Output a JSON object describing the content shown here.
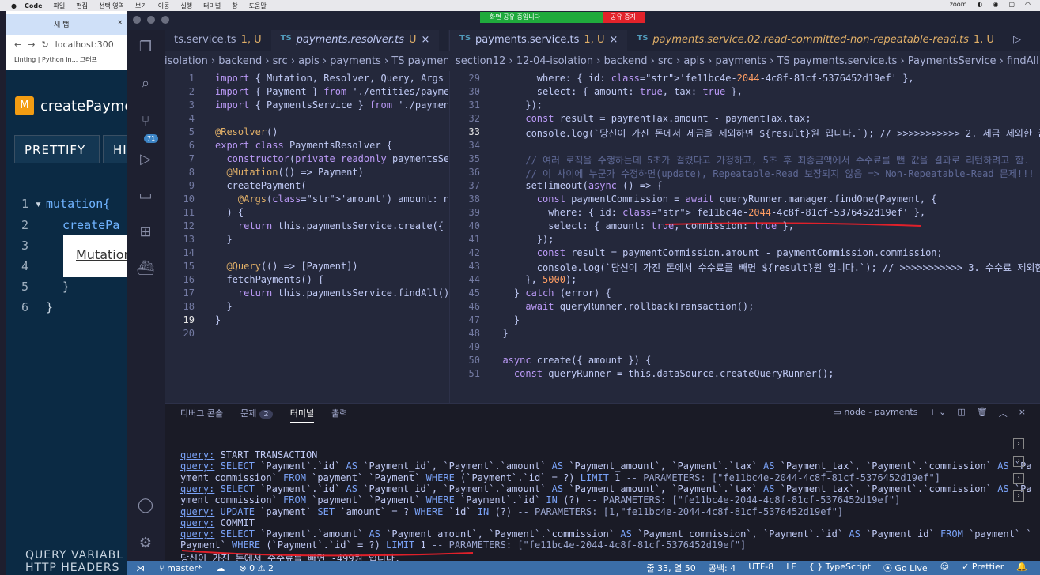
{
  "mac_menu": {
    "app": "Code",
    "items": [
      "파일",
      "편집",
      "선택 영역",
      "보기",
      "이동",
      "실행",
      "터미널",
      "창",
      "도움말"
    ],
    "right": [
      "zoom"
    ]
  },
  "share_bar": {
    "status": "화면 공유 중입니다",
    "stop": "공유 중지"
  },
  "browser": {
    "tab_title": "새 탭",
    "address": "localhost:300",
    "bookmark": "Linting | Python in...",
    "bookmark2": "그래프"
  },
  "graphql": {
    "title": "createPayme",
    "prettify": "PRETTIFY",
    "history": "HIS",
    "code_lines": [
      {
        "num": "1",
        "text": "mutation{"
      },
      {
        "num": "2",
        "text": "createPa"
      },
      {
        "num": "3",
        "text": ""
      },
      {
        "num": "4",
        "text": ""
      },
      {
        "num": "5",
        "text": "}"
      },
      {
        "num": "6",
        "text": "}"
      }
    ],
    "tooltip": "Mutation",
    "query_variables": "QUERY VARIABL",
    "http_headers": "HTTP HEADERS"
  },
  "editor_left": {
    "tabs": [
      {
        "name": "ts.service.ts",
        "suffix": "1, U",
        "active": false
      },
      {
        "name": "payments.resolver.ts",
        "suffix": "U",
        "active": true
      }
    ],
    "breadcrumb": "isolation  ›  backend  ›  src  ›  apis  ›  payments  ›  TS payments",
    "lines": [
      "import { Mutation, Resolver, Query, Args }",
      "import { Payment } from './entities/paymen",
      "import { PaymentsService } from './payment",
      "",
      "@Resolver()",
      "export class PaymentsResolver {",
      "  constructor(private readonly paymentsSer",
      "  @Mutation(() => Payment)",
      "  createPayment(",
      "    @Args('amount') amount: number, //",
      "  ) {",
      "    return this.paymentsService.create({ a",
      "  }",
      "",
      "  @Query(() => [Payment])",
      "  fetchPayments() {",
      "    return this.paymentsService.findAll();",
      "  }",
      "}",
      ""
    ]
  },
  "editor_right": {
    "tabs": [
      {
        "name": "payments.service.ts",
        "suffix": "1, U",
        "active": true
      },
      {
        "name": "payments.service.02.read-committed-non-repeatable-read.ts",
        "suffix": "1, U",
        "active": false
      }
    ],
    "breadcrumb": "section12  ›  12-04-isolation  ›  backend  ›  src  ›  apis  ›  payments  ›  TS payments.service.ts  ›  PaymentsService  ›  findAll",
    "lines": [
      {
        "n": "29",
        "t": "        where: { id: 'fe11bc4e-2044-4c8f-81cf-5376452d19ef' },"
      },
      {
        "n": "30",
        "t": "        select: { amount: true, tax: true },"
      },
      {
        "n": "31",
        "t": "      });"
      },
      {
        "n": "32",
        "t": "      const result = paymentTax.amount - paymentTax.tax;"
      },
      {
        "n": "33",
        "t": "      console.log(`당신이 가진 돈에서 세금을 제외하면 ${result}원 입니다.`); // >>>>>>>>>>> 2. 세금 제외한 금액"
      },
      {
        "n": "34",
        "t": ""
      },
      {
        "n": "35",
        "t": "      // 여러 로직을 수행하는데 5초가 걸렸다고 가정하고, 5초 후 최종금액에서 수수료를 뺀 값을 결과로 리턴하려고 함."
      },
      {
        "n": "36",
        "t": "      // 이 사이에 누군가 수정하면(update), Repeatable-Read 보장되지 않음 => Non-Repeatable-Read 문제!!!"
      },
      {
        "n": "37",
        "t": "      setTimeout(async () => {"
      },
      {
        "n": "38",
        "t": "        const paymentCommission = await queryRunner.manager.findOne(Payment, {"
      },
      {
        "n": "39",
        "t": "          where: { id: 'fe11bc4e-2044-4c8f-81cf-5376452d19ef' },"
      },
      {
        "n": "40",
        "t": "          select: { amount: true, commission: true },"
      },
      {
        "n": "41",
        "t": "        });"
      },
      {
        "n": "42",
        "t": "        const result = paymentCommission.amount - paymentCommission.commission;"
      },
      {
        "n": "43",
        "t": "        console.log(`당신이 가진 돈에서 수수료를 빼면 ${result}원 입니다.`); // >>>>>>>>>>> 3. 수수료 제외한 금"
      },
      {
        "n": "44",
        "t": "      }, 5000);"
      },
      {
        "n": "45",
        "t": "    } catch (error) {"
      },
      {
        "n": "46",
        "t": "      await queryRunner.rollbackTransaction();"
      },
      {
        "n": "47",
        "t": "    }"
      },
      {
        "n": "48",
        "t": "  }"
      },
      {
        "n": "49",
        "t": ""
      },
      {
        "n": "50",
        "t": "  async create({ amount }) {"
      },
      {
        "n": "51",
        "t": "    const queryRunner = this.dataSource.createQueryRunner();"
      }
    ]
  },
  "panel": {
    "tabs": {
      "debug": "디버그 콘솔",
      "problems": "문제",
      "problems_count": "2",
      "terminal": "터미널",
      "output": "출력"
    },
    "terminal_name": "node - payments",
    "lines": [
      "query: START TRANSACTION",
      "query: SELECT `Payment`.`id` AS `Payment_id`, `Payment`.`amount` AS `Payment_amount`, `Payment`.`tax` AS `Payment_tax`, `Payment`.`commission` AS `Pa",
      "yment_commission` FROM `payment` `Payment` WHERE (`Payment`.`id` = ?) LIMIT 1 -- PARAMETERS: [\"fe11bc4e-2044-4c8f-81cf-5376452d19ef\"]",
      "query: SELECT `Payment`.`id` AS `Payment_id`, `Payment`.`amount` AS `Payment_amount`, `Payment`.`tax` AS `Payment_tax`, `Payment`.`commission` AS `Pa",
      "yment_commission` FROM `payment` `Payment` WHERE `Payment`.`id` IN (?) -- PARAMETERS: [\"fe11bc4e-2044-4c8f-81cf-5376452d19ef\"]",
      "query: UPDATE `payment` SET `amount` = ? WHERE `id` IN (?) -- PARAMETERS: [1,\"fe11bc4e-2044-4c8f-81cf-5376452d19ef\"]",
      "query: COMMIT",
      "query: SELECT `Payment`.`amount` AS `Payment_amount`, `Payment`.`commission` AS `Payment_commission`, `Payment`.`id` AS `Payment_id` FROM `payment` `",
      "Payment` WHERE (`Payment`.`id` = ?) LIMIT 1 -- PARAMETERS: [\"fe11bc4e-2044-4c8f-81cf-5376452d19ef\"]",
      "당신이 가진 돈에서 수수료를 빼면 -499원 입니다.",
      "▯"
    ]
  },
  "status_bar": {
    "branch": "master*",
    "problems": "⊗ 0 ⚠ 2",
    "position": "줄 33, 열 50",
    "spaces": "공백: 4",
    "encoding": "UTF-8",
    "eol": "LF",
    "language": "{ } TypeScript",
    "golive": "Go Live",
    "prettier": "✓ Prettier"
  },
  "colors": {
    "accent": "#3b6ea8",
    "underline_red": "#e0202a"
  }
}
